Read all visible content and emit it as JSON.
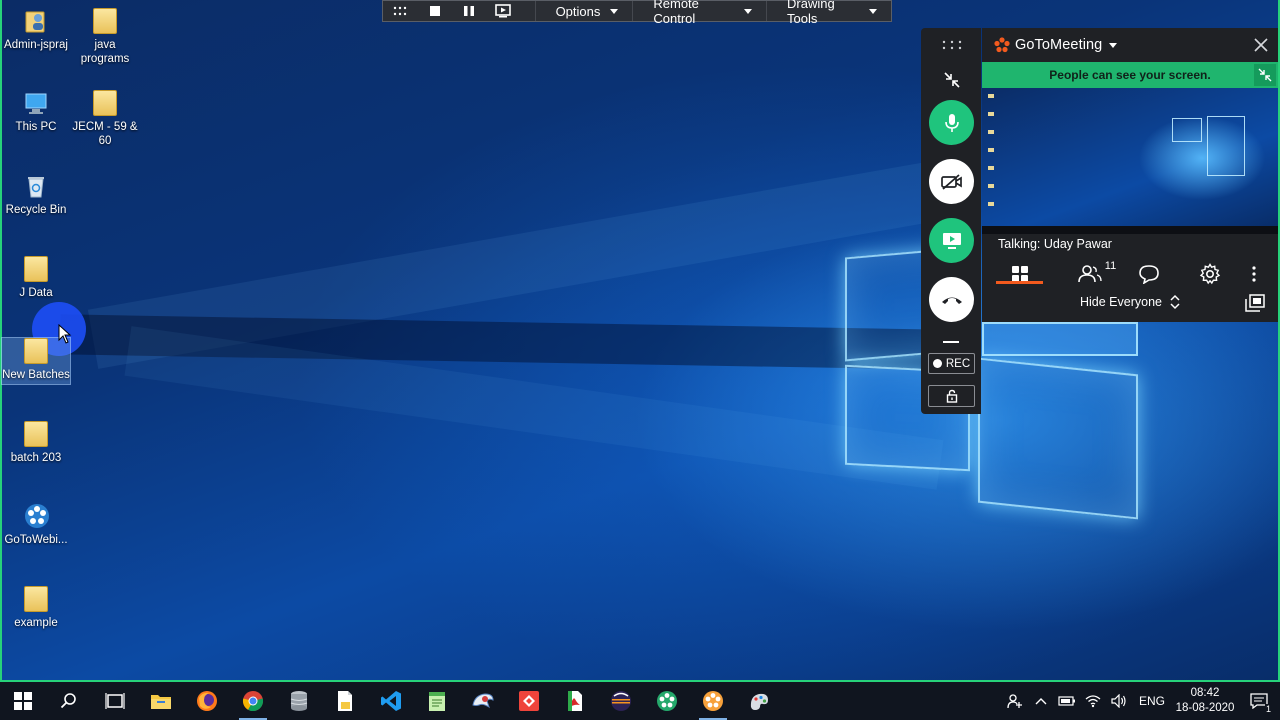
{
  "desktop": {
    "icons": [
      {
        "label": "Admin-jspraj",
        "icon": "user-folder-icon"
      },
      {
        "label": "java programs",
        "icon": "folder-icon"
      },
      {
        "label": "This PC",
        "icon": "computer-icon"
      },
      {
        "label": "JECM - 59 & 60",
        "icon": "folder-icon"
      },
      {
        "label": "Recycle Bin",
        "icon": "recycle-bin-icon"
      },
      {
        "label": "J Data",
        "icon": "folder-icon"
      },
      {
        "label": "New Batches",
        "icon": "folder-icon"
      },
      {
        "label": "batch 203",
        "icon": "folder-icon"
      },
      {
        "label": "GoToWebi...",
        "icon": "gotowebinar-icon"
      },
      {
        "label": "example",
        "icon": "folder-icon"
      }
    ]
  },
  "toolbar": {
    "options_label": "Options",
    "remote_control_label": "Remote Control",
    "drawing_tools_label": "Drawing Tools"
  },
  "side_controls": {
    "rec_label": "REC"
  },
  "meeting_panel": {
    "brand": "GoToMeeting",
    "banner": "People can see your screen.",
    "talking": "Talking: Uday Pawar",
    "attendee_count": "11",
    "hide_everyone_label": "Hide Everyone"
  },
  "taskbar": {
    "language": "ENG",
    "time": "08:42",
    "date": "18-08-2020",
    "notification_count": "1"
  },
  "colors": {
    "accent_green": "#1fc47d",
    "gotomeeting_orange": "#f25a1e",
    "toolbar_bg": "#2b2e34",
    "panel_bg": "#1f2125"
  }
}
